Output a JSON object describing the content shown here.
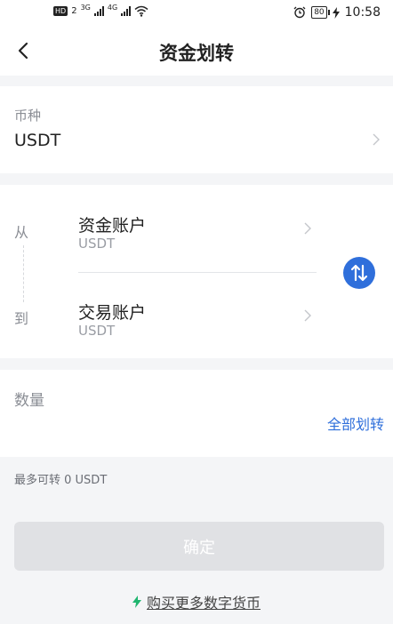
{
  "status_bar": {
    "hd_badge": "HD",
    "sim_slot": "2",
    "network_1": "3G",
    "network_2": "4G",
    "battery": "80",
    "time": "10:58"
  },
  "header": {
    "title": "资金划转"
  },
  "coin": {
    "label": "币种",
    "value": "USDT"
  },
  "transfer": {
    "from_label": "从",
    "to_label": "到",
    "from_account": {
      "name": "资金账户",
      "currency": "USDT"
    },
    "to_account": {
      "name": "交易账户",
      "currency": "USDT"
    }
  },
  "amount": {
    "label": "数量",
    "input_value": "",
    "transfer_all_label": "全部划转"
  },
  "max_transfer": "最多可转 0 USDT",
  "confirm_label": "确定",
  "buy_more_label": "购买更多数字货币",
  "colors": {
    "accent": "#2f6fdb",
    "disabled_button": "#e0e1e4",
    "bolt": "#1fb56f",
    "page_bg": "#f4f5f7"
  }
}
